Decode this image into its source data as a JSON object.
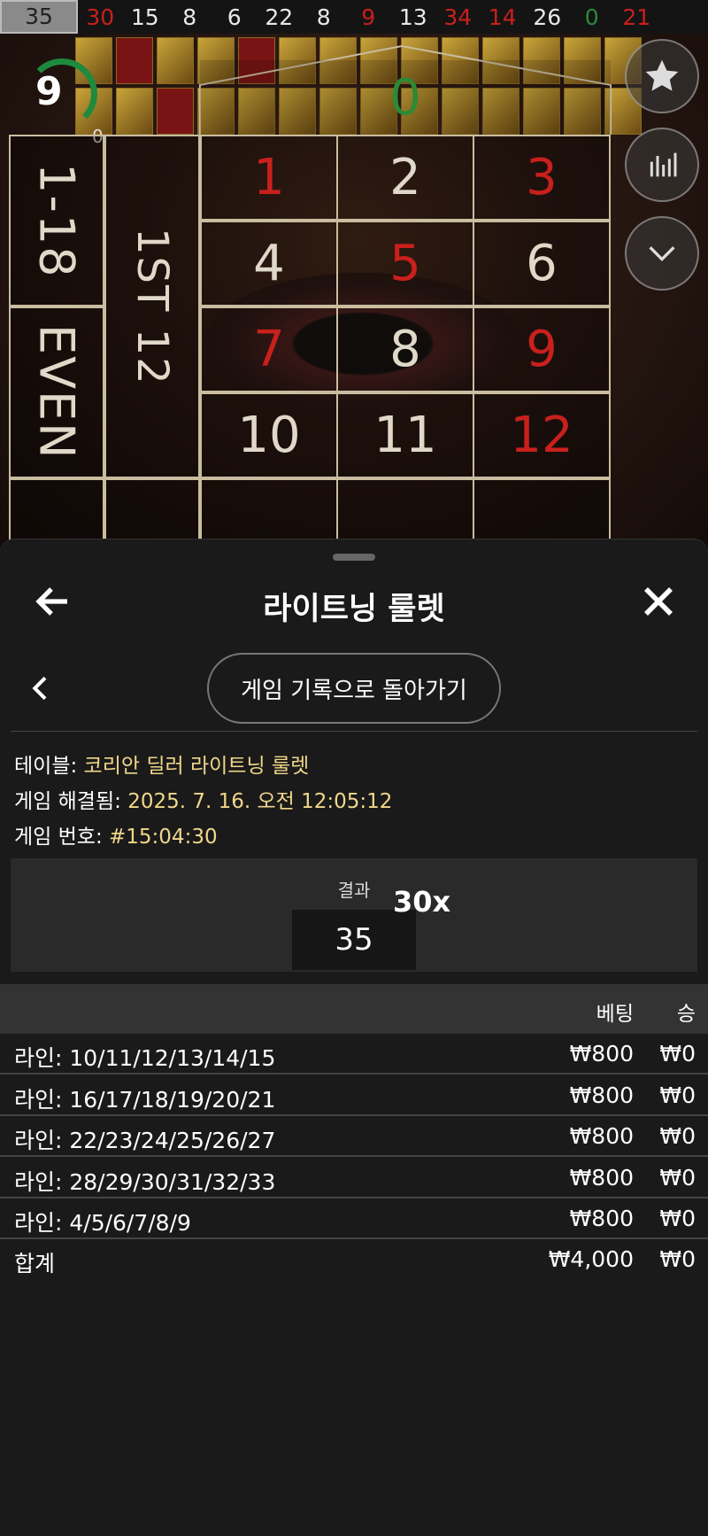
{
  "history": [
    "35",
    "30",
    "15",
    "8",
    "6",
    "22",
    "8",
    "9",
    "13",
    "34",
    "14",
    "26",
    "0",
    "21"
  ],
  "history_colors": [
    "first",
    "red",
    "white",
    "white",
    "white",
    "white",
    "white",
    "red",
    "white",
    "red",
    "red",
    "white",
    "green",
    "red"
  ],
  "game": {
    "timer": "9",
    "timer_sub": "0",
    "zero": "0",
    "numbers": [
      {
        "n": "1",
        "color": "red"
      },
      {
        "n": "2",
        "color": "black"
      },
      {
        "n": "3",
        "color": "red"
      },
      {
        "n": "4",
        "color": "black"
      },
      {
        "n": "5",
        "color": "red"
      },
      {
        "n": "6",
        "color": "black"
      },
      {
        "n": "7",
        "color": "red"
      },
      {
        "n": "8",
        "color": "black"
      },
      {
        "n": "9",
        "color": "red"
      },
      {
        "n": "10",
        "color": "black"
      },
      {
        "n": "11",
        "color": "black"
      },
      {
        "n": "12",
        "color": "red"
      }
    ],
    "range_low": "1-18",
    "even": "EVEN",
    "dozen": "1ST 12",
    "side_buttons": [
      "star-icon",
      "stats-icon",
      "chevron-down-icon"
    ]
  },
  "sheet": {
    "title": "라이트닝 룰렛",
    "back_to_history": "게임 기록으로 돌아가기",
    "table_label": "테이블:",
    "table_value": "코리안 딜러 라이트닝 룰렛",
    "resolved_label": "게임 해결됨:",
    "resolved_value": "2025. 7. 16. 오전 12:05:12",
    "game_no_label": "게임 번호:",
    "game_no_value": "#15:04:30",
    "result_label": "결과",
    "result_value": "35",
    "multiplier": "30x",
    "col_bet": "베팅",
    "col_win": "승",
    "rows": [
      {
        "label": "라인: 10/11/12/13/14/15",
        "bet": "₩800",
        "win": "₩0"
      },
      {
        "label": "라인: 16/17/18/19/20/21",
        "bet": "₩800",
        "win": "₩0"
      },
      {
        "label": "라인: 22/23/24/25/26/27",
        "bet": "₩800",
        "win": "₩0"
      },
      {
        "label": "라인: 28/29/30/31/32/33",
        "bet": "₩800",
        "win": "₩0"
      },
      {
        "label": "라인: 4/5/6/7/8/9",
        "bet": "₩800",
        "win": "₩0"
      }
    ],
    "total": {
      "label": "합계",
      "bet": "₩4,000",
      "win": "₩0"
    }
  },
  "colors": {
    "red": "#c8201c",
    "green": "#2c8a35",
    "gold": "#f0d78a"
  }
}
